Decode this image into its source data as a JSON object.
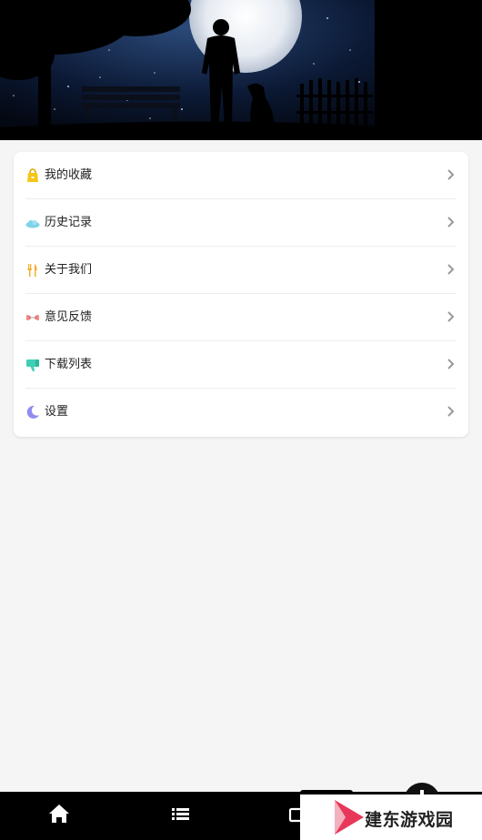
{
  "menu": {
    "items": [
      {
        "label": "我的收藏",
        "icon": "bag-icon"
      },
      {
        "label": "历史记录",
        "icon": "cloud-icon"
      },
      {
        "label": "关于我们",
        "icon": "cutlery-icon"
      },
      {
        "label": "意见反馈",
        "icon": "dumbbell-icon"
      },
      {
        "label": "下载列表",
        "icon": "thumbs-down-icon"
      },
      {
        "label": "设置",
        "icon": "moon-icon"
      }
    ]
  },
  "colors": {
    "bag": "#f5c518",
    "cloud": "#7fd3e8",
    "cutlery": "#f2b134",
    "dumbbell": "#f08a8a",
    "thumbs": "#3ecfb4",
    "moon": "#8f8cf0"
  },
  "watermark": {
    "text": "建东游戏园"
  }
}
